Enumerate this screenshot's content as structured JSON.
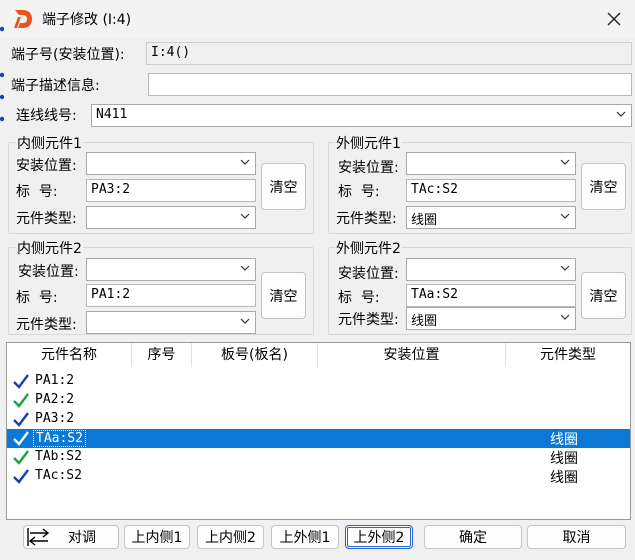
{
  "window": {
    "title": "端子修改 (I:4)"
  },
  "terminal": {
    "id_label": "端子号(安装位置):",
    "id_value": "I:4()",
    "desc_label": "端子描述信息:",
    "desc_value": "",
    "wire_label": "连线线号:",
    "wire_value": "N411"
  },
  "inner1": {
    "title": "内侧元件1",
    "loc_label": "安装位置:",
    "loc_value": "",
    "tag_label": "标  号:",
    "tag_value": "PA3:2",
    "type_label": "元件类型:",
    "type_value": "",
    "clear": "清空"
  },
  "outer1": {
    "title": "外侧元件1",
    "loc_label": "安装位置:",
    "loc_value": "",
    "tag_label": "标  号:",
    "tag_value": "TAc:S2",
    "type_label": "元件类型:",
    "type_value": "线圈",
    "clear": "清空"
  },
  "inner2": {
    "title": "内侧元件2",
    "loc_label": "安装位置:",
    "loc_value": "",
    "tag_label": "标  号:",
    "tag_value": "PA1:2",
    "type_label": "元件类型:",
    "type_value": "",
    "clear": "清空"
  },
  "outer2": {
    "title": "外侧元件2",
    "loc_label": "安装位置:",
    "loc_value": "",
    "tag_label": "标  号:",
    "tag_value": "TAa:S2",
    "type_label": "元件类型:",
    "type_value": "线圈",
    "clear": "清空"
  },
  "list": {
    "headers": [
      "元件名称",
      "序号",
      "板号(板名)",
      "安装位置",
      "元件类型"
    ],
    "rows": [
      {
        "name": "PA1:2",
        "type": "",
        "check": "blue"
      },
      {
        "name": "PA2:2",
        "type": "",
        "check": "green"
      },
      {
        "name": "PA3:2",
        "type": "",
        "check": "blue"
      },
      {
        "name": "TAa:S2",
        "type": "线圈",
        "check": "blue",
        "selected": true
      },
      {
        "name": "TAb:S2",
        "type": "线圈",
        "check": "green"
      },
      {
        "name": "TAc:S2",
        "type": "线圈",
        "check": "blue"
      }
    ]
  },
  "buttons": {
    "swap": "对调",
    "up_inner1": "上内侧1",
    "up_inner2": "上内侧2",
    "up_outer1": "上外侧1",
    "up_outer2": "上外侧2",
    "ok": "确定",
    "cancel": "取消"
  },
  "colors": {
    "selection": "#0a78d4",
    "check_blue": "#1a3fb8",
    "check_green": "#20a040",
    "logo": "#e8541a"
  }
}
